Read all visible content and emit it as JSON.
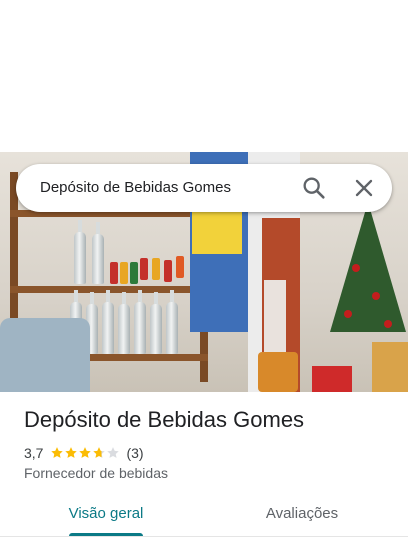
{
  "search": {
    "query": "Depósito de Bebidas Gomes",
    "search_icon": "search-icon",
    "close_icon": "close-icon"
  },
  "place": {
    "name": "Depósito de Bebidas Gomes",
    "rating": "3,7",
    "stars_filled": 3.7,
    "stars_total": 5,
    "review_count": "(3)",
    "category": "Fornecedor de bebidas"
  },
  "tabs": [
    {
      "label": "Visão geral",
      "selected": true
    },
    {
      "label": "Avaliações",
      "selected": false
    }
  ],
  "colors": {
    "accent": "#0b7a86",
    "star": "#fbbc04",
    "star_empty": "#dadce0",
    "title": "#202124",
    "secondary": "#5f6368"
  }
}
